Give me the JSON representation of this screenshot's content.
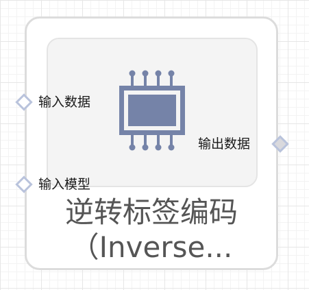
{
  "node": {
    "title_line1": "逆转标签编码",
    "title_line2": "（Inverse...",
    "icon": "chip-icon",
    "icon_color": "#7583a8",
    "ports": {
      "input_data_label": "输入数据",
      "input_model_label": "输入模型",
      "output_data_label": "输出数据"
    }
  }
}
